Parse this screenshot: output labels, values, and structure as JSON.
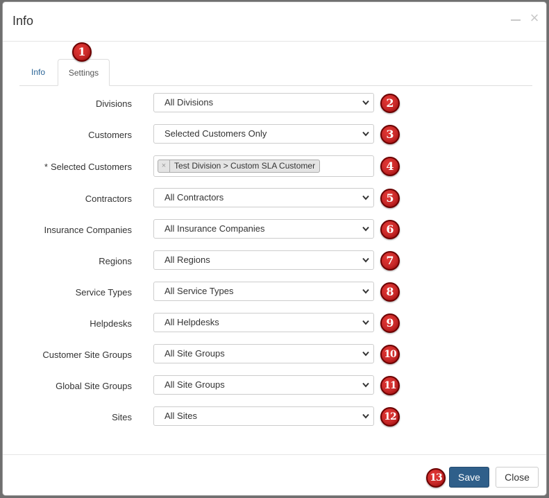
{
  "dialog": {
    "title": "Info",
    "close_glyph": "×"
  },
  "tabs": [
    {
      "label": "Info"
    },
    {
      "label": "Settings",
      "active": true
    }
  ],
  "fields": [
    {
      "label": "Divisions",
      "value": "All Divisions",
      "marker": "2"
    },
    {
      "label": "Customers",
      "value": "Selected Customers Only",
      "marker": "3"
    },
    {
      "label": "Selected Customers",
      "required_mark": "*",
      "chip_remove": "×",
      "chip": "Test Division > Custom SLA Customer",
      "marker": "4"
    },
    {
      "label": "Contractors",
      "value": "All Contractors",
      "marker": "5"
    },
    {
      "label": "Insurance Companies",
      "value": "All Insurance Companies",
      "marker": "6"
    },
    {
      "label": "Regions",
      "value": "All Regions",
      "marker": "7"
    },
    {
      "label": "Service Types",
      "value": "All Service Types",
      "marker": "8"
    },
    {
      "label": "Helpdesks",
      "value": "All Helpdesks",
      "marker": "9"
    },
    {
      "label": "Customer Site Groups",
      "value": "All Site Groups",
      "marker": "10"
    },
    {
      "label": "Global Site Groups",
      "value": "All Site Groups",
      "marker": "11"
    },
    {
      "label": "Sites",
      "value": "All Sites",
      "marker": "12"
    }
  ],
  "markers": {
    "tab": "1",
    "save": "13"
  },
  "footer": {
    "save_label": "Save",
    "close_label": "Close"
  },
  "colors": {
    "marker_red": "#c62828",
    "save_button": "#2f5f8a",
    "tab_link": "#2a6496"
  }
}
